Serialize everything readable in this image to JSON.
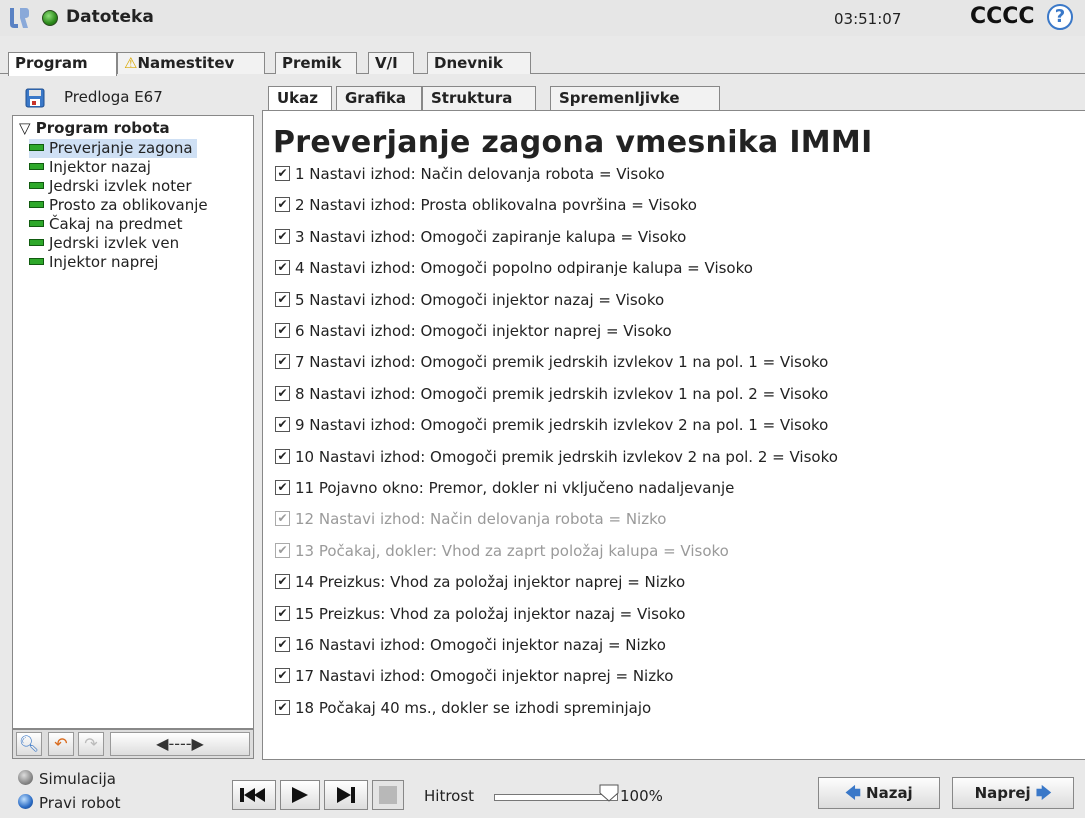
{
  "titlebar": {
    "app_title": "Datoteka",
    "clock": "03:51:07",
    "robot_name": "CCCC"
  },
  "top_tabs": [
    "Program",
    "Namestitev",
    "Premik",
    "V/I",
    "Dnevnik"
  ],
  "left_panel": {
    "template_label": "Predloga E67",
    "tree_root": "Program robota",
    "tree_items": [
      "Preverjanje zagona",
      "Injektor nazaj",
      "Jedrski izvlek noter",
      "Prosto za oblikovanje",
      "Čakaj na predmet",
      "Jedrski izvlek ven",
      "Injektor naprej"
    ],
    "selected_index": 0
  },
  "sub_tabs": [
    "Ukaz",
    "Grafika",
    "Struktura",
    "Spremenljivke"
  ],
  "main": {
    "heading": "Preverjanje zagona vmesnika IMMI",
    "steps": [
      {
        "text": "1 Nastavi izhod: Način delovanja robota = Visoko",
        "checked": true,
        "enabled": true
      },
      {
        "text": "2 Nastavi izhod: Prosta oblikovalna površina = Visoko",
        "checked": true,
        "enabled": true
      },
      {
        "text": "3 Nastavi izhod: Omogoči zapiranje kalupa = Visoko",
        "checked": true,
        "enabled": true
      },
      {
        "text": "4 Nastavi izhod: Omogoči popolno odpiranje kalupa = Visoko",
        "checked": true,
        "enabled": true
      },
      {
        "text": "5 Nastavi izhod: Omogoči injektor nazaj = Visoko",
        "checked": true,
        "enabled": true
      },
      {
        "text": "6 Nastavi izhod: Omogoči injektor naprej = Visoko",
        "checked": true,
        "enabled": true
      },
      {
        "text": "7 Nastavi izhod: Omogoči premik jedrskih izvlekov 1 na pol. 1 = Visoko",
        "checked": true,
        "enabled": true
      },
      {
        "text": "8 Nastavi izhod: Omogoči premik jedrskih izvlekov 1 na pol. 2 = Visoko",
        "checked": true,
        "enabled": true
      },
      {
        "text": "9 Nastavi izhod: Omogoči premik jedrskih izvlekov 2 na pol. 1 = Visoko",
        "checked": true,
        "enabled": true
      },
      {
        "text": "10 Nastavi izhod: Omogoči premik jedrskih izvlekov 2 na pol. 2 = Visoko",
        "checked": true,
        "enabled": true
      },
      {
        "text": "11 Pojavno okno: Premor, dokler ni vključeno nadaljevanje",
        "checked": true,
        "enabled": true
      },
      {
        "text": "12 Nastavi izhod: Način delovanja robota = Nizko",
        "checked": true,
        "enabled": false
      },
      {
        "text": "13 Počakaj, dokler: Vhod za zaprt položaj kalupa = Visoko",
        "checked": true,
        "enabled": false
      },
      {
        "text": "14 Preizkus: Vhod za položaj injektor naprej = Nizko",
        "checked": true,
        "enabled": true
      },
      {
        "text": "15 Preizkus: Vhod za položaj injektor nazaj = Visoko",
        "checked": true,
        "enabled": true
      },
      {
        "text": "16 Nastavi izhod: Omogoči injektor nazaj = Nizko",
        "checked": true,
        "enabled": true
      },
      {
        "text": "17 Nastavi izhod: Omogoči injektor naprej = Nizko",
        "checked": true,
        "enabled": true
      },
      {
        "text": "18 Počakaj 40 ms., dokler se izhodi spreminjajo",
        "checked": true,
        "enabled": true
      }
    ]
  },
  "bottom": {
    "mode_sim": "Simulacija",
    "mode_real": "Pravi robot",
    "speed_label": "Hitrost",
    "speed_value": "100%",
    "speed_fraction": 1.0,
    "back_label": "Nazaj",
    "next_label": "Naprej"
  },
  "colors": {
    "accent": "#3a78c8",
    "tree_selection": "#cfe0f4",
    "status_green": "#2ea82a",
    "warning": "#f2c200"
  },
  "icons": [
    "ur-logo-icon",
    "status-dot-icon",
    "help-icon",
    "warning-icon",
    "floppy-icon",
    "search-icon",
    "undo-icon",
    "redo-icon",
    "move-arrows-icon",
    "skip-back-icon",
    "play-icon",
    "step-icon",
    "stop-icon",
    "arrow-left-icon",
    "arrow-right-icon"
  ]
}
